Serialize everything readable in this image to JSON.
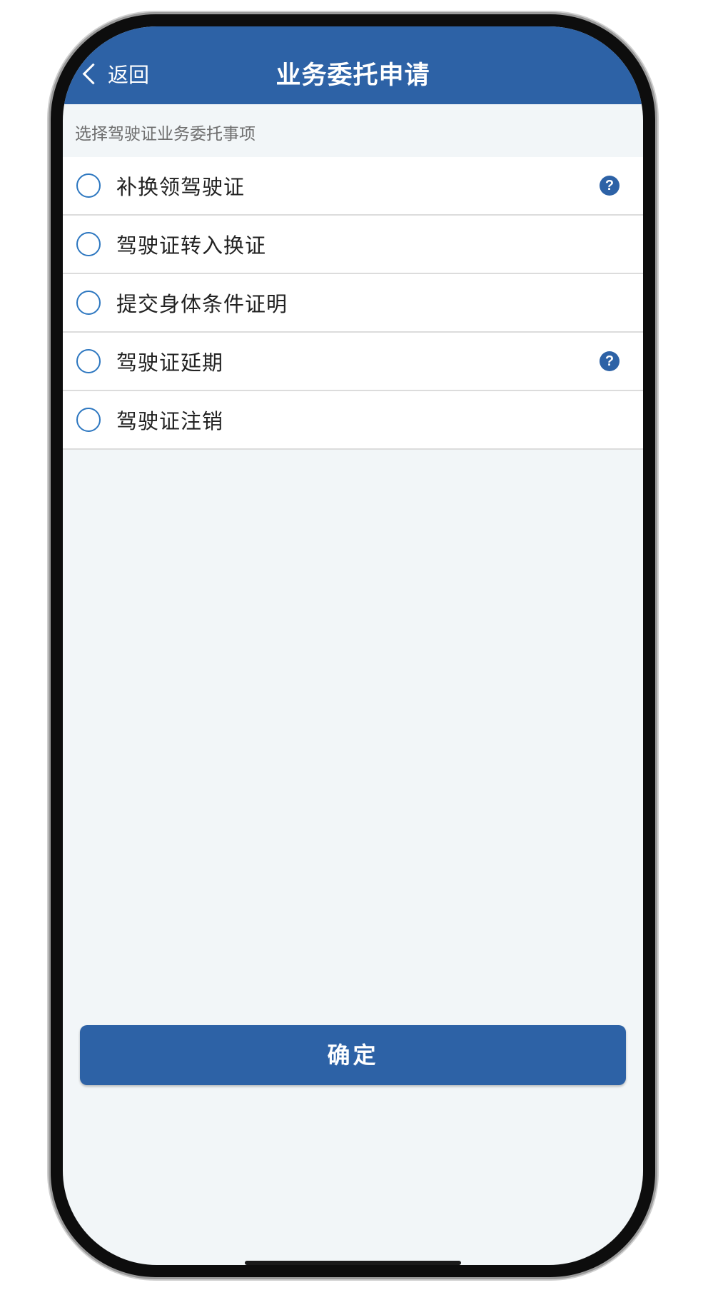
{
  "header": {
    "back_label": "返回",
    "title": "业务委托申请"
  },
  "section": {
    "hint": "选择驾驶证业务委托事项"
  },
  "options": [
    {
      "label": "补换领驾驶证",
      "has_help": true,
      "selected": false
    },
    {
      "label": "驾驶证转入换证",
      "has_help": false,
      "selected": false
    },
    {
      "label": "提交身体条件证明",
      "has_help": false,
      "selected": false
    },
    {
      "label": "驾驶证延期",
      "has_help": true,
      "selected": false
    },
    {
      "label": "驾驶证注销",
      "has_help": false,
      "selected": false
    }
  ],
  "help_icon_glyph": "?",
  "footer": {
    "confirm_label": "确定"
  },
  "colors": {
    "primary": "#2d62a6",
    "radio_border": "#2d77c0",
    "background": "#f2f6f8"
  }
}
